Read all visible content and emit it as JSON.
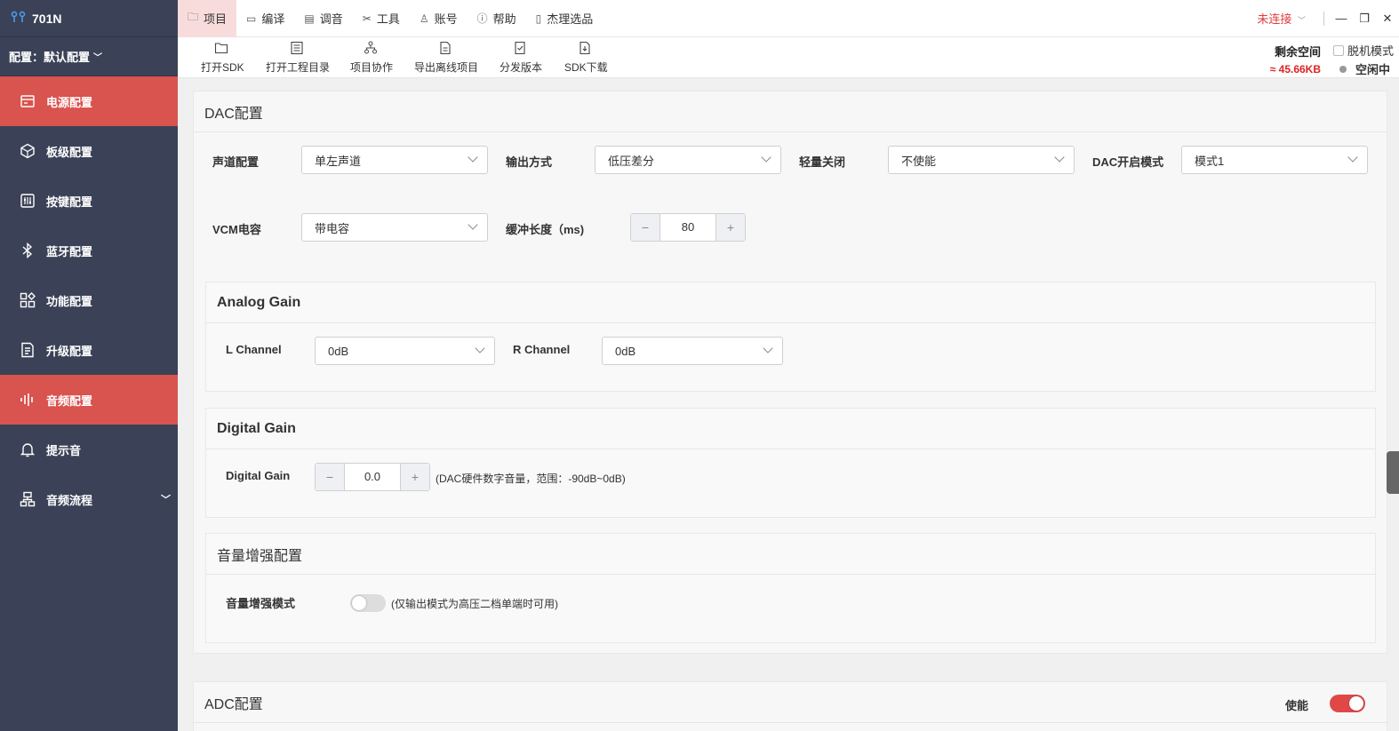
{
  "app": {
    "title": "701N"
  },
  "sidebar": {
    "config_label": "配置：默认配置",
    "items": [
      {
        "label": "电源配置",
        "icon": "power-config-icon"
      },
      {
        "label": "板级配置",
        "icon": "board-config-icon"
      },
      {
        "label": "按键配置",
        "icon": "key-config-icon"
      },
      {
        "label": "蓝牙配置",
        "icon": "bluetooth-icon"
      },
      {
        "label": "功能配置",
        "icon": "function-config-icon"
      },
      {
        "label": "升级配置",
        "icon": "upgrade-config-icon"
      },
      {
        "label": "音频配置",
        "icon": "audio-config-icon"
      },
      {
        "label": "提示音",
        "icon": "bell-icon"
      },
      {
        "label": "音频流程",
        "icon": "audio-flow-icon"
      }
    ]
  },
  "menu": {
    "items": [
      {
        "label": "项目"
      },
      {
        "label": "编译"
      },
      {
        "label": "调音"
      },
      {
        "label": "工具"
      },
      {
        "label": "账号"
      },
      {
        "label": "帮助"
      },
      {
        "label": "杰理选品"
      }
    ],
    "connection": "未连接"
  },
  "toolbar": {
    "items": [
      {
        "label": "打开SDK"
      },
      {
        "label": "打开工程目录"
      },
      {
        "label": "项目协作"
      },
      {
        "label": "导出离线项目"
      },
      {
        "label": "分发版本"
      },
      {
        "label": "SDK下载"
      }
    ],
    "space_label": "剩余空间",
    "space_value": "≈ 45.66KB",
    "offline_label": "脱机模式",
    "status": "空闲中"
  },
  "dac": {
    "title": "DAC配置",
    "channel_label": "声道配置",
    "channel_value": "单左声道",
    "output_label": "输出方式",
    "output_value": "低压差分",
    "mute_label": "轻量关闭",
    "mute_value": "不使能",
    "mode_label": "DAC开启模式",
    "mode_value": "模式1",
    "vcm_label": "VCM电容",
    "vcm_value": "带电容",
    "buffer_label": "缓冲长度（ms)",
    "buffer_value": "80",
    "analog": {
      "title": "Analog Gain",
      "l_label": "L Channel",
      "l_value": "0dB",
      "r_label": "R Channel",
      "r_value": "0dB"
    },
    "digital": {
      "title": "Digital Gain",
      "label": "Digital Gain",
      "value": "0.0",
      "hint": "(DAC硬件数字音量，范围：-90dB~0dB)"
    },
    "boost": {
      "title": "音量增强配置",
      "label": "音量增强模式",
      "hint": "(仅输出模式为高压二档单端时可用)",
      "enabled": false
    }
  },
  "adc": {
    "title": "ADC配置",
    "enable_label": "使能",
    "enabled": true
  },
  "colors": {
    "accent": "#d9534f",
    "sidebar": "#3b4257",
    "disconnected": "#e03b3b",
    "space": "#e02222"
  }
}
